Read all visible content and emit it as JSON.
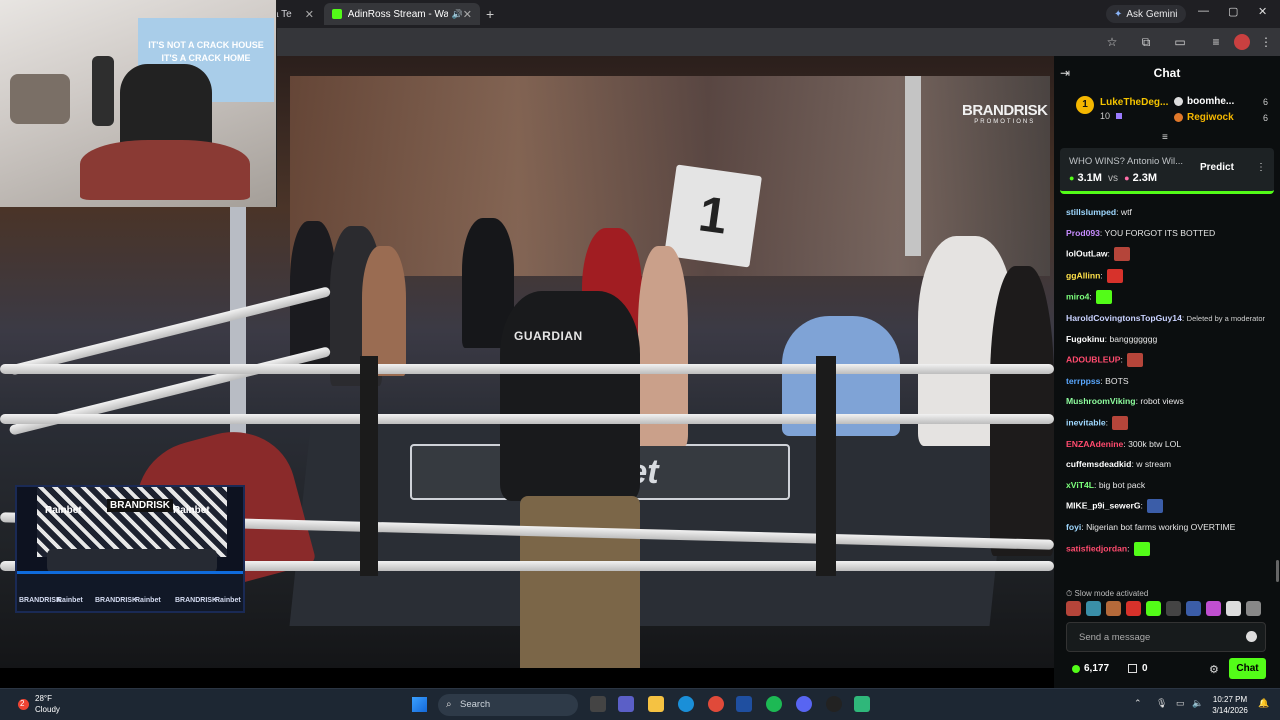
{
  "browser": {
    "tabs": [
      {
        "label": "ca Te",
        "active": false
      },
      {
        "label": "AdinRoss Stream - Watch Li",
        "active": true
      }
    ],
    "new_tab": "+",
    "gemini_label": "Ask Gemini",
    "window_controls": [
      "—",
      "▢",
      "✕"
    ]
  },
  "video": {
    "sponsor_logo": "BRANDRISK",
    "sponsor_sub": "PROMOTIONS",
    "round_card": "1",
    "mat_text": "Roobet",
    "guardian_text": "GUARDIAN",
    "webcam_flag_line1": "IT'S NOT A CRACK HOUSE",
    "webcam_flag_line2": "IT'S A CRACK HOME",
    "pip_sponsors": [
      "Rainbet",
      "BRANDRISK",
      "Rainbet"
    ],
    "pip_footer": [
      "BRANDRISK",
      "Rainbet",
      "BRANDRISK",
      "Rainbet",
      "BRANDRISK",
      "Rainbet"
    ]
  },
  "chat": {
    "title": "Chat",
    "leaderboard": {
      "first": {
        "rank": "1",
        "name": "LukeTheDeg...",
        "count": "10"
      },
      "others": [
        {
          "name": "boomhe...",
          "count": "6",
          "color": "#ffffff",
          "dot": "#dddddd"
        },
        {
          "name": "Regiwock",
          "count": "6",
          "color": "#f5b700",
          "dot": "#e0782a"
        }
      ]
    },
    "prediction": {
      "question": "WHO WINS? Antonio Wil...",
      "left_value": "3.1M",
      "vs": "vs",
      "right_value": "2.3M",
      "button": "Predict"
    },
    "messages": [
      {
        "user": "stillslumped",
        "color": "#9fd8ff",
        "text": "wtf",
        "emote": ""
      },
      {
        "user": "Prod093",
        "color": "#c78cff",
        "text": "YOU FORGOT ITS BOTTED",
        "emote": ""
      },
      {
        "user": "lolOutLaw",
        "color": "#ffffff",
        "text": "",
        "emote": "#b5453a"
      },
      {
        "user": "ggAllinn",
        "color": "#ffe14a",
        "text": "",
        "emote": "#d7322b"
      },
      {
        "user": "miro4",
        "color": "#7cff7c",
        "text": "",
        "emote": "#53fc18"
      },
      {
        "user": "HaroldCovingtonsTopGuy14",
        "color": "#c9d2ff",
        "text": "",
        "mod_note": "Deleted by a moderator",
        "emote": ""
      },
      {
        "user": "Fugokinu",
        "color": "#ffffff",
        "text": "banggggggg",
        "emote": ""
      },
      {
        "user": "ADOUBLEUP",
        "color": "#ff4b6e",
        "text": "",
        "emote": "#b5453a"
      },
      {
        "user": "terrppss",
        "color": "#5aa8ff",
        "text": "BOTS",
        "emote": ""
      },
      {
        "user": "MushroomViking",
        "color": "#8fff9f",
        "text": "robot views",
        "emote": ""
      },
      {
        "user": "inevitable",
        "color": "#9fd8ff",
        "text": "",
        "emote": "#b5453a"
      },
      {
        "user": "ENZAAdenine",
        "color": "#ff4b6e",
        "text": "300k btw LOL",
        "emote": ""
      },
      {
        "user": "cuffemsdeadkid",
        "color": "#ffffff",
        "text": "w stream",
        "emote": ""
      },
      {
        "user": "xViT4L",
        "color": "#7cff7c",
        "text": "big bot pack",
        "emote": ""
      },
      {
        "user": "MIKE_p9i_sewerG",
        "color": "#ffffff",
        "text": "",
        "emote": "#3b5da8"
      },
      {
        "user": "foyi",
        "color": "#9fd8ff",
        "text": "Nigerian bot farms working OVERTIME",
        "emote": ""
      },
      {
        "user": "satisfiedjordan",
        "color": "#ff4b6e",
        "text": "",
        "emote": "#53fc18"
      }
    ],
    "slow_mode": "Slow mode activated",
    "send_placeholder": "Send a message",
    "points": "6,177",
    "gift_count": "0",
    "chat_button": "Chat"
  },
  "taskbar": {
    "weather_temp": "28°F",
    "weather_desc": "Cloudy",
    "weather_badge": "2",
    "search_label": "Search",
    "time": "10:27 PM",
    "date": "3/14/2026"
  }
}
